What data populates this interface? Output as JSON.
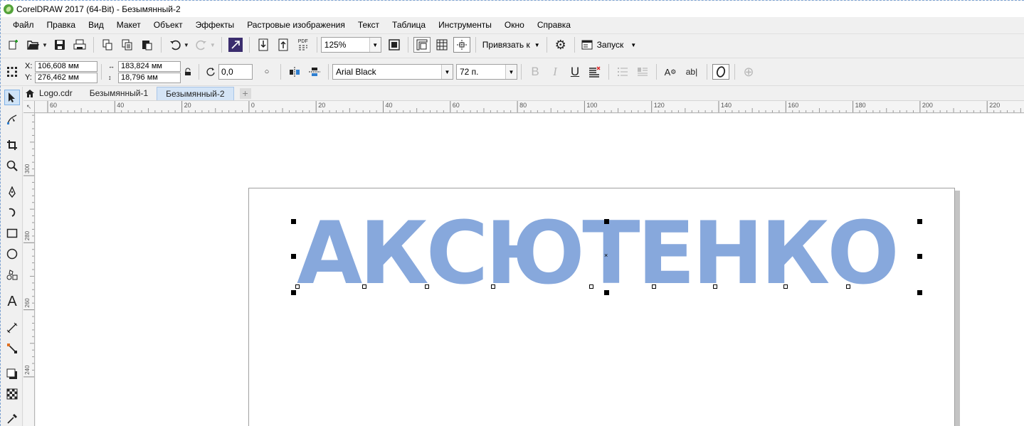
{
  "window": {
    "title": "CorelDRAW 2017 (64-Bit) - Безымянный-2"
  },
  "menu": [
    "Файл",
    "Правка",
    "Вид",
    "Макет",
    "Объект",
    "Эффекты",
    "Растровые изображения",
    "Текст",
    "Таблица",
    "Инструменты",
    "Окно",
    "Справка"
  ],
  "toolbar": {
    "zoom": "125%",
    "snap_label": "Привязать к",
    "launch_label": "Запуск",
    "pdf_label": "PDF"
  },
  "property_bar": {
    "x_label": "X:",
    "y_label": "Y:",
    "x_value": "106,608 мм",
    "y_value": "276,462 мм",
    "width_value": "183,824 мм",
    "height_value": "18,796 мм",
    "rotation_value": "0,0",
    "font_name": "Arial Black",
    "font_size": "72 п.",
    "bold_label": "B",
    "italic_label": "I",
    "underline_label": "U",
    "abc_label": "ab",
    "char_label": "A"
  },
  "tabs": [
    "Logo.cdr",
    "Безымянный-1",
    "Безымянный-2"
  ],
  "active_tab": "Безымянный-2",
  "ruler": {
    "corner": "↖",
    "h_labels": [
      "60",
      "40",
      "20",
      "0",
      "20",
      "40",
      "60",
      "80",
      "100",
      "120",
      "140",
      "160",
      "180",
      "200",
      "220"
    ],
    "v_labels": [
      "300",
      "280",
      "260",
      "240"
    ]
  },
  "canvas": {
    "text": "АКСЮТЕНКО",
    "text_color": "#87a8dc"
  }
}
